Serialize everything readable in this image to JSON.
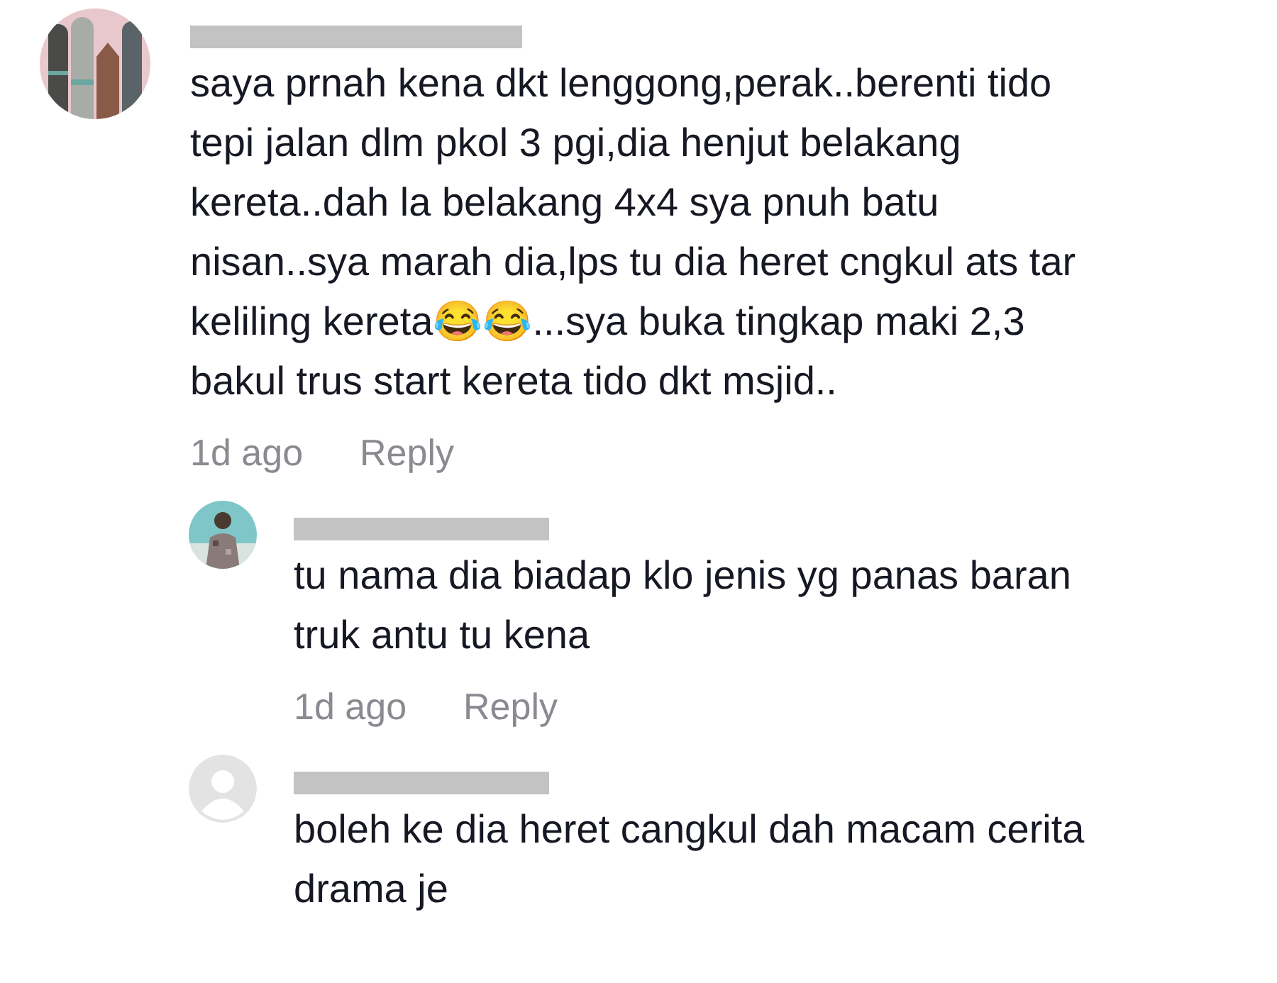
{
  "comments": [
    {
      "lines": [
        "saya prnah kena dkt lenggong,perak..berenti tido",
        "tepi jalan dlm pkol 3 pgi,dia henjut belakang",
        "kereta..dah la belakang 4x4 sya pnuh batu",
        "nisan..sya marah dia,lps tu dia heret cngkul ats tar",
        "keliling kereta😂😂...sya buka tingkap maki 2,3",
        "bakul trus start kereta tido dkt msjid.."
      ],
      "time": "1d ago",
      "reply": "Reply",
      "replies": [
        {
          "lines": [
            "tu nama dia biadap klo jenis yg panas baran",
            "truk antu tu kena"
          ],
          "time": "1d ago",
          "reply": "Reply"
        },
        {
          "avatar": {
            "kind": "default"
          },
          "lines": [
            "boleh ke dia heret cangkul dah macam cerita",
            "drama je"
          ]
        }
      ]
    }
  ]
}
